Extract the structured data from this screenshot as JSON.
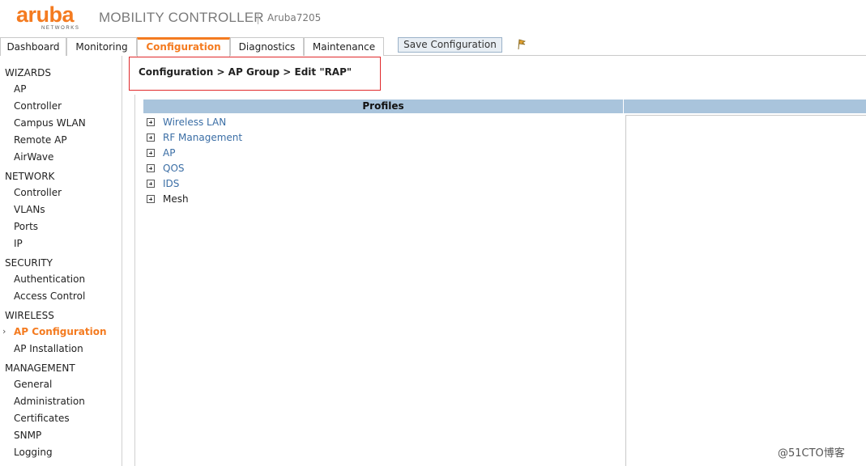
{
  "header": {
    "logo_text": "aruba",
    "logo_subtext": "NETWORKS",
    "product": "MOBILITY CONTROLLER",
    "hostname": "Aruba7205"
  },
  "tabs": [
    {
      "label": "Dashboard"
    },
    {
      "label": "Monitoring"
    },
    {
      "label": "Configuration"
    },
    {
      "label": "Diagnostics"
    },
    {
      "label": "Maintenance"
    }
  ],
  "toolbar": {
    "save_label": "Save Configuration",
    "flag_icon": "flag-icon"
  },
  "sidebar": {
    "sections": [
      {
        "title": "WIZARDS",
        "items": [
          "AP",
          "Controller",
          "Campus WLAN",
          "Remote AP",
          "AirWave"
        ]
      },
      {
        "title": "NETWORK",
        "items": [
          "Controller",
          "VLANs",
          "Ports",
          "IP"
        ]
      },
      {
        "title": "SECURITY",
        "items": [
          "Authentication",
          "Access Control"
        ]
      },
      {
        "title": "WIRELESS",
        "items": [
          "AP Configuration",
          "AP Installation"
        ]
      },
      {
        "title": "MANAGEMENT",
        "items": [
          "General",
          "Administration",
          "Certificates",
          "SNMP",
          "Logging"
        ]
      }
    ],
    "active_item": "AP Configuration",
    "active_arrow": "›"
  },
  "breadcrumb": "Configuration > AP Group > Edit \"RAP\"",
  "profiles": {
    "header": "Profiles",
    "items": [
      {
        "label": "Wireless LAN"
      },
      {
        "label": "RF Management"
      },
      {
        "label": "AP"
      },
      {
        "label": "QOS"
      },
      {
        "label": "IDS"
      },
      {
        "label": "Mesh"
      }
    ]
  },
  "watermark": "@51CTO博客",
  "colors": {
    "accent": "#f47b20",
    "link": "#3b6ea5",
    "table_header": "#a9c4dc",
    "highlight_border": "#e0292b"
  }
}
